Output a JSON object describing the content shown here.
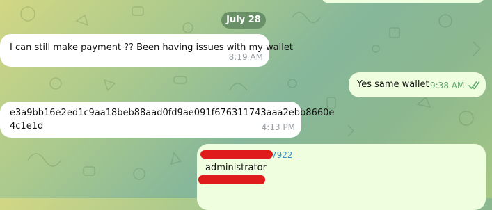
{
  "date_separator": "July 28",
  "messages": [
    {
      "direction": "incoming",
      "text": "I can still make payment ?? Been having issues with my wallet",
      "time": "8:19 AM"
    },
    {
      "direction": "outgoing",
      "text": "Yes same wallet",
      "time": "9:38 AM",
      "status": "read-double-check"
    },
    {
      "direction": "incoming",
      "text_line1": "e3a9bb16e2ed1c9aa18beb88aad0fd9ae091f676311743aaa2ebb8660e",
      "text_line2": "4c1e1d",
      "time": "4:13 PM"
    },
    {
      "direction": "outgoing",
      "sender_suffix": "7922",
      "text": "administrator",
      "redacted": true
    }
  ],
  "colors": {
    "incoming_bubble": "#ffffff",
    "outgoing_bubble": "#eefedf",
    "outgoing_time": "#5ea66b",
    "link": "#3a8fc4",
    "redaction": "#e01b1b"
  }
}
